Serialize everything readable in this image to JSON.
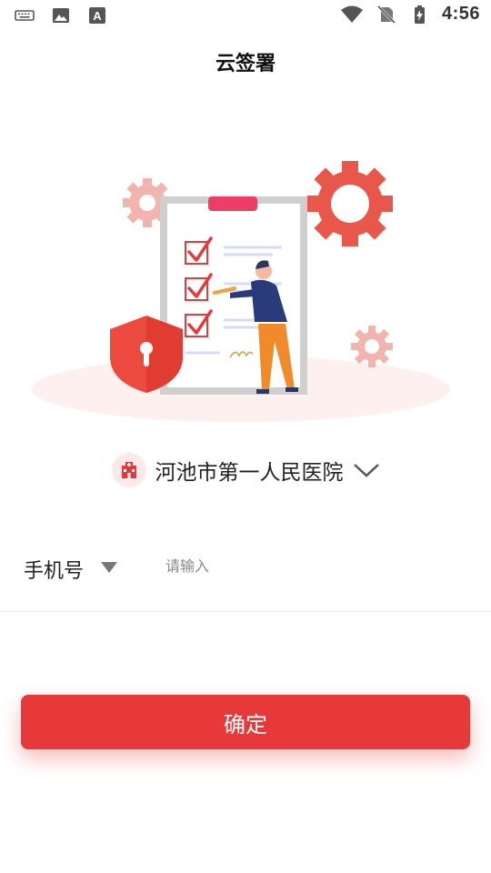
{
  "status_bar": {
    "time": "4:56",
    "left_icons": [
      "keyboard-icon",
      "image-icon",
      "font-icon"
    ],
    "right_icons": [
      "wifi-icon",
      "no-sim-icon",
      "battery-charging-icon"
    ]
  },
  "header": {
    "title": "云签署"
  },
  "illustration": {
    "description_icons": [
      "gear-icon",
      "shield-lock-icon",
      "clipboard-checklist-icon",
      "person-writing-icon"
    ],
    "accent_color": "#e8393a"
  },
  "hospital_selector": {
    "name": "河池市第一人民医院",
    "icon": "hospital-icon",
    "chevron": "chevron-down-icon"
  },
  "login_form": {
    "phone_label": "手机号",
    "phone_value": "",
    "phone_placeholder": "请输入"
  },
  "actions": {
    "confirm_label": "确定"
  },
  "colors": {
    "primary": "#e8393a",
    "background": "#ffffff"
  }
}
